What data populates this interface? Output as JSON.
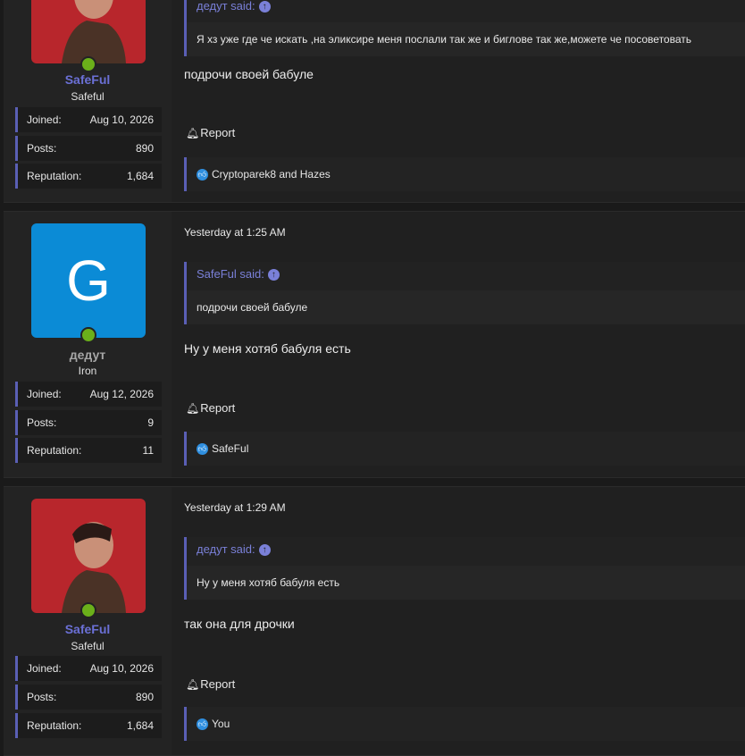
{
  "posts": [
    {
      "username": "SafeFul",
      "user_title": "Safeful",
      "avatar": {
        "type": "photo",
        "letter": "",
        "bg": "#b8262c"
      },
      "name_color": "#6b70d6",
      "stats": [
        {
          "label": "Joined:",
          "value": "Aug 10, 2026"
        },
        {
          "label": "Posts:",
          "value": "890"
        },
        {
          "label": "Reputation:",
          "value": "1,684"
        }
      ],
      "date": "",
      "quote_author": "дедут said:",
      "quote_text": "Я хз уже где че искать ,на эликсире меня послали так же и биглове так же,можете че посоветовать",
      "message": "подрочи своей бабуле",
      "report_label": "Report",
      "likes": "Cryptoparek8 and Hazes"
    },
    {
      "username": "дедут",
      "user_title": "Iron",
      "avatar": {
        "type": "letter",
        "letter": "G",
        "bg": "#0b8bd6"
      },
      "name_color": "#a6a6a6",
      "stats": [
        {
          "label": "Joined:",
          "value": "Aug 12, 2026"
        },
        {
          "label": "Posts:",
          "value": "9"
        },
        {
          "label": "Reputation:",
          "value": "11"
        }
      ],
      "date": "Yesterday at 1:25 AM",
      "quote_author": "SafeFul said:",
      "quote_text": "подрочи своей бабуле",
      "message": "Ну у меня хотяб бабуля есть",
      "report_label": "Report",
      "likes": "SafeFul"
    },
    {
      "username": "SafeFul",
      "user_title": "Safeful",
      "avatar": {
        "type": "photo",
        "letter": "",
        "bg": "#b8262c"
      },
      "name_color": "#6b70d6",
      "stats": [
        {
          "label": "Joined:",
          "value": "Aug 10, 2026"
        },
        {
          "label": "Posts:",
          "value": "890"
        },
        {
          "label": "Reputation:",
          "value": "1,684"
        }
      ],
      "date": "Yesterday at 1:29 AM",
      "quote_author": "дедут said:",
      "quote_text": "Ну у меня хотяб бабуля есть",
      "message": "так она для дрочки",
      "report_label": "Report",
      "likes": "You"
    }
  ]
}
